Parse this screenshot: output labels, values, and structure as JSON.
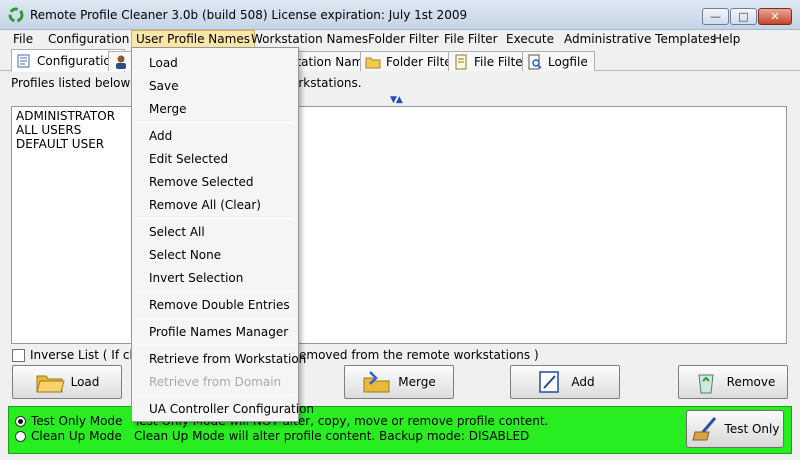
{
  "window": {
    "title": "Remote Profile Cleaner 3.0b (build 508)   License expiration: July 1st 2009",
    "min_label": "—",
    "max_label": "□",
    "close_label": "✕"
  },
  "menubar": {
    "items": [
      "File",
      "Configuration",
      "User Profile Names",
      "Workstation Names",
      "Folder Filter",
      "File Filter",
      "Execute",
      "Administrative Templates",
      "Help"
    ]
  },
  "tabs": {
    "items": [
      "Configuration",
      "...tation Names",
      "Folder Filter",
      "File Filter",
      "Logfile"
    ]
  },
  "info": {
    "text": "Profiles listed below will N",
    "text_tail": "orkstations.",
    "sort_arrows": "▼▲"
  },
  "profiles": {
    "rows": [
      "ADMINISTRATOR",
      "ALL USERS",
      "DEFAULT USER"
    ]
  },
  "inverse": {
    "label": "Inverse List ( If check",
    "label_tail": "emoved from the remote workstations )"
  },
  "buttons": {
    "load": "Load",
    "merge": "Merge",
    "add": "Add",
    "remove": "Remove",
    "test_only": "Test Only"
  },
  "status": {
    "test_mode_label": "Test Only Mode",
    "cleanup_mode_label": "Clean Up Mode",
    "test_mode_desc": "Test Only Mode will NOT alter, copy, move or remove profile content.",
    "cleanup_mode_desc": "Clean Up Mode will alter profile content. Backup mode: DISABLED"
  },
  "dropdown": {
    "items": [
      {
        "label": "Load",
        "enabled": true
      },
      {
        "label": "Save",
        "enabled": true
      },
      {
        "label": "Merge",
        "enabled": true
      },
      {
        "label": "Add",
        "enabled": true
      },
      {
        "label": "Edit Selected",
        "enabled": true
      },
      {
        "label": "Remove Selected",
        "enabled": true
      },
      {
        "label": "Remove All (Clear)",
        "enabled": true
      },
      {
        "label": "Select All",
        "enabled": true
      },
      {
        "label": "Select None",
        "enabled": true
      },
      {
        "label": "Invert Selection",
        "enabled": true
      },
      {
        "label": "Remove Double Entries",
        "enabled": true
      },
      {
        "label": "Profile Names Manager",
        "enabled": true
      },
      {
        "label": "Retrieve from Workstation",
        "enabled": true
      },
      {
        "label": "Retrieve from Domain",
        "enabled": false
      },
      {
        "label": "UA Controller Configuration",
        "enabled": true
      }
    ]
  },
  "colors": {
    "status_green": "#28ed20",
    "menu_highlight": "#fbe6a8"
  }
}
